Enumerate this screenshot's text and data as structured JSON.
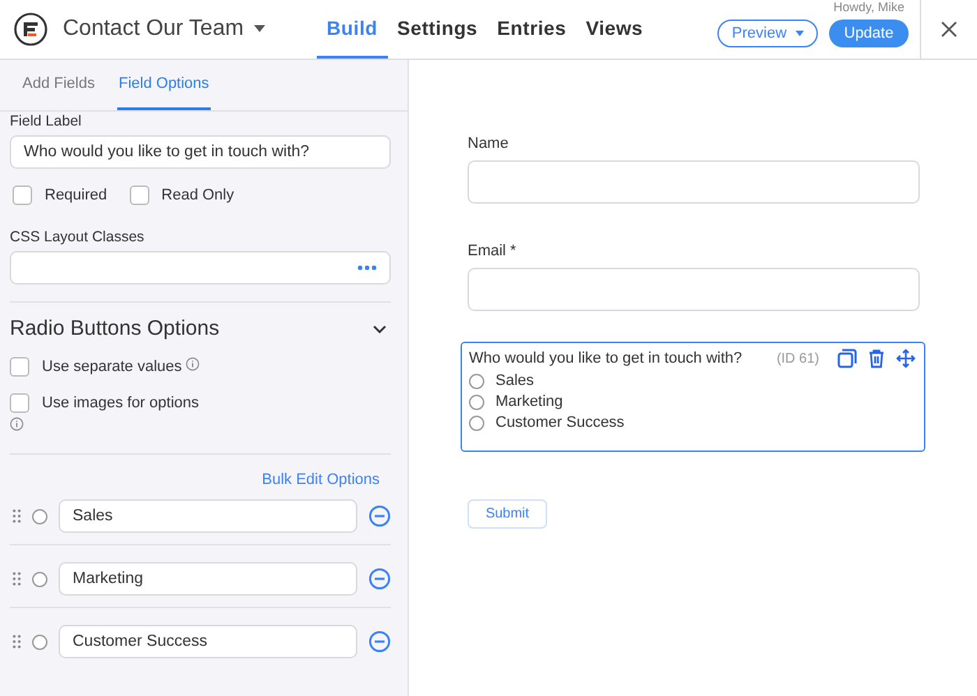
{
  "header": {
    "form_title": "Contact Our Team",
    "nav": [
      {
        "label": "Build",
        "selected": true
      },
      {
        "label": "Settings",
        "selected": false
      },
      {
        "label": "Entries",
        "selected": false
      },
      {
        "label": "Views",
        "selected": false
      }
    ],
    "preview_button": "Preview",
    "update_button": "Update",
    "greeting": "Howdy, Mike"
  },
  "sidebar": {
    "tabs": [
      {
        "label": "Add Fields",
        "selected": false
      },
      {
        "label": "Field Options",
        "selected": true
      }
    ],
    "field_label": {
      "label": "Field Label",
      "value": "Who would you like to get in touch with?"
    },
    "flags": [
      {
        "label": "Required",
        "checked": false
      },
      {
        "label": "Read Only",
        "checked": false
      }
    ],
    "css_classes": {
      "label": "CSS Layout Classes"
    },
    "section_title": "Radio Buttons Options",
    "section_expanded": true,
    "settings": [
      {
        "label": "Use separate values",
        "checked": false,
        "info_inline": true
      },
      {
        "label": "Use images for options",
        "checked": false,
        "info_inline": false
      }
    ],
    "bulk_edit": "Bulk Edit Options",
    "options": [
      {
        "value": "Sales",
        "selected": false
      },
      {
        "value": "Marketing",
        "selected": false
      },
      {
        "value": "Customer Success",
        "selected": false
      }
    ]
  },
  "form": {
    "fields": [
      {
        "kind": "text",
        "label": "Name"
      },
      {
        "kind": "text",
        "label": "Email *"
      },
      {
        "kind": "radio",
        "label": "Who would you like to get in touch with?",
        "id_label": "(ID 61)",
        "options": [
          {
            "label": "Sales",
            "selected": false
          },
          {
            "label": "Marketing",
            "selected": false
          },
          {
            "label": "Customer Success",
            "selected": false
          }
        ]
      }
    ],
    "submit": "Submit"
  }
}
